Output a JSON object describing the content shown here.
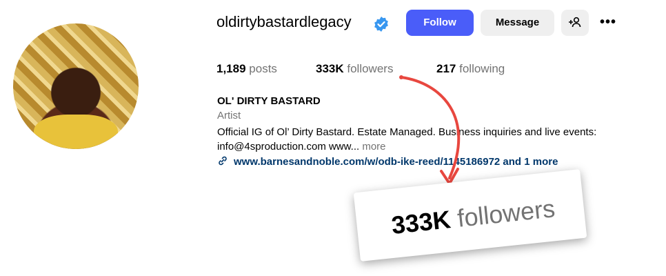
{
  "profile": {
    "username": "oldirtybastardlegacy",
    "verified": true,
    "full_name": "OL' DIRTY BASTARD",
    "category": "Artist",
    "bio_text": "Official IG of Ol’ Dirty Bastard. Estate Managed. Business inquiries and live events: info@4sproduction.com www...",
    "bio_more": "more",
    "link_text": "www.barnesandnoble.com/w/odb-ike-reed/1145186972 and 1 more"
  },
  "actions": {
    "follow_label": "Follow",
    "message_label": "Message",
    "add_user_label": "+👤",
    "more_label": "•••"
  },
  "stats": {
    "posts_count": "1,189",
    "posts_label": "posts",
    "followers_count": "333K",
    "followers_label": "followers",
    "following_count": "217",
    "following_label": "following"
  },
  "zoom_callout": {
    "count": "333K",
    "label": "followers"
  },
  "colors": {
    "follow_button": "#4a5df9",
    "verified_badge": "#3897f0",
    "link": "#00376b",
    "arrow": "#e8473f",
    "muted_text": "#737373"
  },
  "icons": {
    "verified": "verified-badge-icon",
    "add_user": "add-person-icon",
    "more": "more-horizontal-icon",
    "link": "link-chain-icon"
  }
}
